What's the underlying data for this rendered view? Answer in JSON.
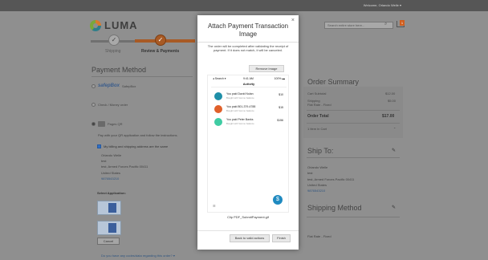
{
  "topbar": {
    "welcome": "Welcome, Orlando Welle ▾"
  },
  "header": {
    "logo_text": "LUMA",
    "search_placeholder": "Search entire store here...",
    "cart_count": "1"
  },
  "progress": {
    "steps": [
      {
        "label": "Shipping",
        "icon": "check-icon",
        "done": true
      },
      {
        "label": "Review & Payments",
        "icon": "check-icon",
        "active": true
      }
    ],
    "step_glyph": "✓"
  },
  "payment": {
    "title": "Payment Method",
    "options": [
      {
        "label": "SafepBox",
        "brand": "safepBox",
        "selected": false
      },
      {
        "label": "Check / Money order",
        "selected": false
      },
      {
        "label": "Pages QR",
        "selected": true
      }
    ],
    "instruction": "Pay with your QR application and follow the instructions.",
    "same_address_label": "My billing and shipping address are the same",
    "address": [
      "Orlando Welle",
      "test",
      "test, Armed Forces Pacific 00411",
      "United States"
    ],
    "phone": "9876543210",
    "select_application": "Select Application:",
    "cancel_label": "Cancel",
    "discount_link": "Do you have any codes/data regarding this order? ▾"
  },
  "modal": {
    "title": "Attach Payment Transaction Image",
    "close_glyph": "×",
    "description": "The order will be completed after validating the receipt of payment. If it does not match, it will be canceled.",
    "remove_label": "Remove image",
    "screenshot": {
      "status_left": "◂ Search ▾",
      "status_center": "9:41 AM",
      "status_right": "100% ▬",
      "header": "Activity",
      "transactions": [
        {
          "name": "You paid David Nolan",
          "sub": "Bought with Venmo balance",
          "amount": "$10",
          "color": "#1f8fa8"
        },
        {
          "name": "You paid 801-379-4788",
          "sub": "Bought with Venmo balance",
          "amount": "$15",
          "color": "#e0602a"
        },
        {
          "name": "You paid Peter Banks",
          "sub": "Bought with Venmo balance",
          "amount": "$156",
          "color": "#3fcca3"
        }
      ],
      "bottom_left": "☰",
      "fab_glyph": "$"
    },
    "filename": "Clip PDF_SubmitPayment.gif",
    "back_label": "Back to valid actions",
    "finish_label": "Finish"
  },
  "summary": {
    "title": "Order Summary",
    "rows": [
      {
        "label": "Cart Subtotal",
        "value": "$12.00"
      },
      {
        "label": "Shipping",
        "value": "$5.00"
      },
      {
        "label": "Flat Rate - Fixed",
        "value": ""
      }
    ],
    "total_label": "Order Total",
    "total_value": "$17.00",
    "items_in_cart": "1 Item in Cart",
    "items_chevron": "⌄"
  },
  "ship_to": {
    "title": "Ship To:",
    "lines": [
      "Orlando Welle",
      "test",
      "test, Armed Forces Pacific 00411",
      "United States"
    ],
    "phone": "9876543210"
  },
  "shipping_method": {
    "title": "Shipping Method",
    "value": "Flat Rate - Fixed"
  },
  "icons": {
    "search": "⌕",
    "pencil": "✎"
  }
}
